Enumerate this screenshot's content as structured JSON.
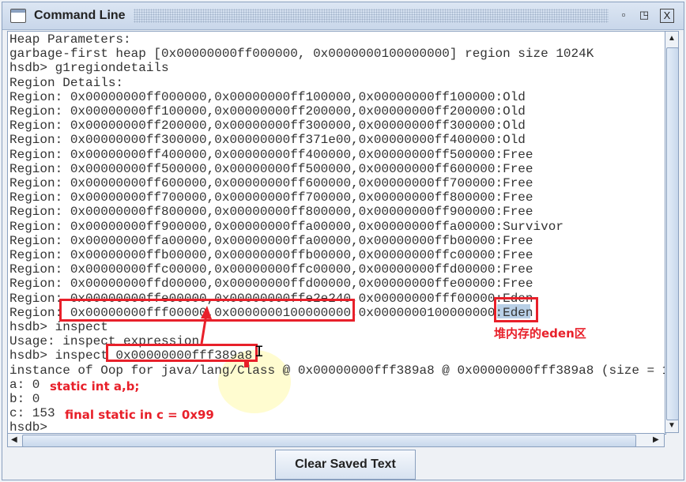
{
  "window": {
    "title": "Command Line",
    "icons": [
      "window-icon",
      "restore-icon",
      "maximize-icon",
      "close-icon"
    ]
  },
  "console": {
    "lines": [
      "Heap Parameters:",
      "garbage-first heap [0x00000000ff000000, 0x0000000100000000] region size 1024K",
      "hsdb> g1regiondetails",
      "Region Details:",
      "Region: 0x00000000ff000000,0x00000000ff100000,0x00000000ff100000:Old",
      "Region: 0x00000000ff100000,0x00000000ff200000,0x00000000ff200000:Old",
      "Region: 0x00000000ff200000,0x00000000ff300000,0x00000000ff300000:Old",
      "Region: 0x00000000ff300000,0x00000000ff371e00,0x00000000ff400000:Old",
      "Region: 0x00000000ff400000,0x00000000ff400000,0x00000000ff500000:Free",
      "Region: 0x00000000ff500000,0x00000000ff500000,0x00000000ff600000:Free",
      "Region: 0x00000000ff600000,0x00000000ff600000,0x00000000ff700000:Free",
      "Region: 0x00000000ff700000,0x00000000ff700000,0x00000000ff800000:Free",
      "Region: 0x00000000ff800000,0x00000000ff800000,0x00000000ff900000:Free",
      "Region: 0x00000000ff900000,0x00000000ffa00000,0x00000000ffa00000:Survivor",
      "Region: 0x00000000ffa00000,0x00000000ffa00000,0x00000000ffb00000:Free",
      "Region: 0x00000000ffb00000,0x00000000ffb00000,0x00000000ffc00000:Free",
      "Region: 0x00000000ffc00000,0x00000000ffc00000,0x00000000ffd00000:Free",
      "Region: 0x00000000ffd00000,0x00000000ffd00000,0x00000000ffe00000:Free",
      "Region: 0x00000000ffe00000,0x00000000ffe2e240,0x00000000fff00000:Eden",
      "Region: 0x00000000fff00000,0x0000000100000000,0x0000000100000000:Eden",
      "hsdb> inspect",
      "Usage: inspect expression",
      "hsdb> inspect 0x00000000fff389a8",
      "instance of Oop for java/lang/Class @ 0x00000000fff389a8 @ 0x00000000fff389a8 (size = 1",
      "a: 0",
      "b: 0",
      "c: 153",
      "hsdb>"
    ]
  },
  "annotations": {
    "eden_note": "堆内存的eden区",
    "static_note": "static int a,b;",
    "final_note": "final static in c = 0x99",
    "color": "#e8202a"
  },
  "footer": {
    "clear_button": "Clear Saved Text"
  }
}
